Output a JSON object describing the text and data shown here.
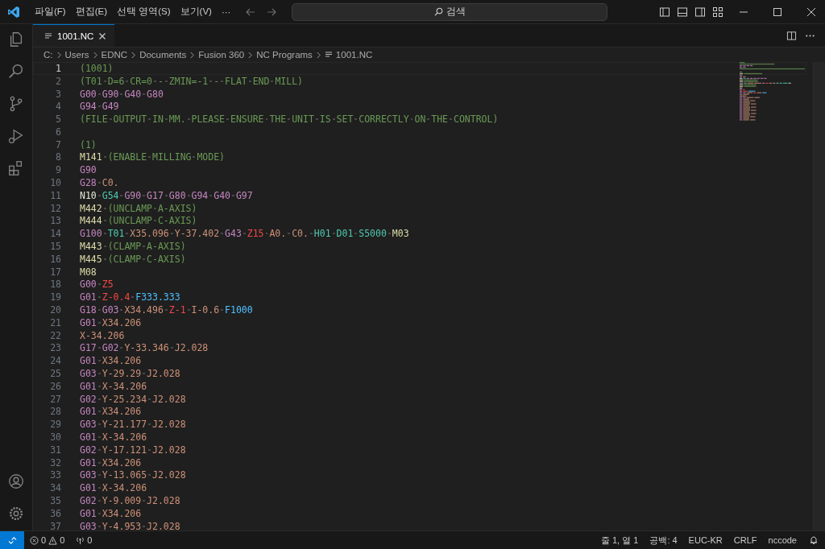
{
  "title_bar": {
    "menus": [
      "파일(F)",
      "편집(E)",
      "선택 영역(S)",
      "보기(V)",
      "···"
    ],
    "search": {
      "placeholder": "검색"
    }
  },
  "tabs": [
    {
      "label": "1001.NC",
      "selected": true
    }
  ],
  "breadcrumbs": [
    "C:",
    "Users",
    "EDNC",
    "Documents",
    "Fusion 360",
    "NC Programs",
    "1001.NC"
  ],
  "editor": {
    "lines": [
      {
        "number": "1",
        "current": true,
        "tokens": [
          {
            "kind": "comment",
            "text": "(1001)"
          }
        ]
      },
      {
        "number": "2",
        "current": false,
        "tokens": [
          {
            "kind": "comment",
            "text": "(T01 D=6 CR=0 - ZMIN=-1 - FLAT END MILL)"
          }
        ]
      },
      {
        "number": "3",
        "current": false,
        "tokens": [
          {
            "kind": "g",
            "text": "G00"
          },
          {
            "kind": "g",
            "text": "G90"
          },
          {
            "kind": "g",
            "text": "G40"
          },
          {
            "kind": "g",
            "text": "G80"
          }
        ]
      },
      {
        "number": "4",
        "current": false,
        "tokens": [
          {
            "kind": "g",
            "text": "G94"
          },
          {
            "kind": "g",
            "text": "G49"
          }
        ]
      },
      {
        "number": "5",
        "current": false,
        "tokens": [
          {
            "kind": "comment",
            "text": "(FILE OUTPUT IN MM. PLEASE ENSURE THE UNIT IS SET CORRECTLY ON THE CONTROL)"
          }
        ]
      },
      {
        "number": "6",
        "current": false
      },
      {
        "number": "7",
        "current": false,
        "tokens": [
          {
            "kind": "comment",
            "text": "(1)"
          }
        ]
      },
      {
        "number": "8",
        "current": false,
        "tokens": [
          {
            "kind": "m",
            "text": "M141"
          },
          {
            "kind": "comment",
            "text": "(ENABLE MILLING MODE)"
          }
        ]
      },
      {
        "number": "9",
        "current": false,
        "tokens": [
          {
            "kind": "g",
            "text": "G90"
          }
        ]
      },
      {
        "number": "10",
        "current": false,
        "tokens": [
          {
            "kind": "g",
            "text": "G28"
          },
          {
            "kind": "coord",
            "text": "C0."
          }
        ]
      },
      {
        "number": "11",
        "current": false,
        "tokens": [
          {
            "kind": "n",
            "text": "N10"
          },
          {
            "kind": "t",
            "text": "G54"
          },
          {
            "kind": "g",
            "text": "G90"
          },
          {
            "kind": "g",
            "text": "G17"
          },
          {
            "kind": "g",
            "text": "G80"
          },
          {
            "kind": "g",
            "text": "G94"
          },
          {
            "kind": "g",
            "text": "G40"
          },
          {
            "kind": "g",
            "text": "G97"
          }
        ]
      },
      {
        "number": "12",
        "current": false,
        "tokens": [
          {
            "kind": "m",
            "text": "M442"
          },
          {
            "kind": "comment",
            "text": "(UNCLAMP A-AXIS)"
          }
        ]
      },
      {
        "number": "13",
        "current": false,
        "tokens": [
          {
            "kind": "m",
            "text": "M444"
          },
          {
            "kind": "comment",
            "text": "(UNCLAMP C-AXIS)"
          }
        ]
      },
      {
        "number": "14",
        "current": false,
        "tokens": [
          {
            "kind": "g",
            "text": "G100"
          },
          {
            "kind": "t",
            "text": "T01"
          },
          {
            "kind": "coord",
            "text": "X35.096"
          },
          {
            "kind": "coord",
            "text": "Y-37.402"
          },
          {
            "kind": "g",
            "text": "G43"
          },
          {
            "kind": "z",
            "text": "Z15"
          },
          {
            "kind": "coord",
            "text": "A0."
          },
          {
            "kind": "coord",
            "text": "C0."
          },
          {
            "kind": "t",
            "text": "H01"
          },
          {
            "kind": "t",
            "text": "D01"
          },
          {
            "kind": "t",
            "text": "S5000"
          },
          {
            "kind": "m",
            "text": "M03"
          }
        ]
      },
      {
        "number": "15",
        "current": false,
        "tokens": [
          {
            "kind": "m",
            "text": "M443"
          },
          {
            "kind": "comment",
            "text": "(CLAMP A-AXIS)"
          }
        ]
      },
      {
        "number": "16",
        "current": false,
        "tokens": [
          {
            "kind": "m",
            "text": "M445"
          },
          {
            "kind": "comment",
            "text": "(CLAMP C-AXIS)"
          }
        ]
      },
      {
        "number": "17",
        "current": false,
        "tokens": [
          {
            "kind": "m",
            "text": "M08"
          }
        ]
      },
      {
        "number": "18",
        "current": false,
        "tokens": [
          {
            "kind": "g",
            "text": "G00"
          },
          {
            "kind": "z",
            "text": "Z5"
          }
        ]
      },
      {
        "number": "19",
        "current": false,
        "tokens": [
          {
            "kind": "g",
            "text": "G01"
          },
          {
            "kind": "z",
            "text": "Z-0.4"
          },
          {
            "kind": "f",
            "text": "F333.333"
          }
        ]
      },
      {
        "number": "20",
        "current": false,
        "tokens": [
          {
            "kind": "g",
            "text": "G18"
          },
          {
            "kind": "g",
            "text": "G03"
          },
          {
            "kind": "coord",
            "text": "X34.496"
          },
          {
            "kind": "z",
            "text": "Z-1"
          },
          {
            "kind": "coord",
            "text": "I-0.6"
          },
          {
            "kind": "f",
            "text": "F1000"
          }
        ]
      },
      {
        "number": "21",
        "current": false,
        "tokens": [
          {
            "kind": "g",
            "text": "G01"
          },
          {
            "kind": "coord",
            "text": "X34.206"
          }
        ]
      },
      {
        "number": "22",
        "current": false,
        "tokens": [
          {
            "kind": "coord",
            "text": "X-34.206"
          }
        ]
      },
      {
        "number": "23",
        "current": false,
        "tokens": [
          {
            "kind": "g",
            "text": "G17"
          },
          {
            "kind": "g",
            "text": "G02"
          },
          {
            "kind": "coord",
            "text": "Y-33.346"
          },
          {
            "kind": "coord",
            "text": "J2.028"
          }
        ]
      },
      {
        "number": "24",
        "current": false,
        "tokens": [
          {
            "kind": "g",
            "text": "G01"
          },
          {
            "kind": "coord",
            "text": "X34.206"
          }
        ]
      },
      {
        "number": "25",
        "current": false,
        "tokens": [
          {
            "kind": "g",
            "text": "G03"
          },
          {
            "kind": "coord",
            "text": "Y-29.29"
          },
          {
            "kind": "coord",
            "text": "J2.028"
          }
        ]
      },
      {
        "number": "26",
        "current": false,
        "tokens": [
          {
            "kind": "g",
            "text": "G01"
          },
          {
            "kind": "coord",
            "text": "X-34.206"
          }
        ]
      },
      {
        "number": "27",
        "current": false,
        "tokens": [
          {
            "kind": "g",
            "text": "G02"
          },
          {
            "kind": "coord",
            "text": "Y-25.234"
          },
          {
            "kind": "coord",
            "text": "J2.028"
          }
        ]
      },
      {
        "number": "28",
        "current": false,
        "tokens": [
          {
            "kind": "g",
            "text": "G01"
          },
          {
            "kind": "coord",
            "text": "X34.206"
          }
        ]
      },
      {
        "number": "29",
        "current": false,
        "tokens": [
          {
            "kind": "g",
            "text": "G03"
          },
          {
            "kind": "coord",
            "text": "Y-21.177"
          },
          {
            "kind": "coord",
            "text": "J2.028"
          }
        ]
      },
      {
        "number": "30",
        "current": false,
        "tokens": [
          {
            "kind": "g",
            "text": "G01"
          },
          {
            "kind": "coord",
            "text": "X-34.206"
          }
        ]
      },
      {
        "number": "31",
        "current": false,
        "tokens": [
          {
            "kind": "g",
            "text": "G02"
          },
          {
            "kind": "coord",
            "text": "Y-17.121"
          },
          {
            "kind": "coord",
            "text": "J2.028"
          }
        ]
      },
      {
        "number": "32",
        "current": false,
        "tokens": [
          {
            "kind": "g",
            "text": "G01"
          },
          {
            "kind": "coord",
            "text": "X34.206"
          }
        ]
      },
      {
        "number": "33",
        "current": false,
        "tokens": [
          {
            "kind": "g",
            "text": "G03"
          },
          {
            "kind": "coord",
            "text": "Y-13.065"
          },
          {
            "kind": "coord",
            "text": "J2.028"
          }
        ]
      },
      {
        "number": "34",
        "current": false,
        "tokens": [
          {
            "kind": "g",
            "text": "G01"
          },
          {
            "kind": "coord",
            "text": "X-34.206"
          }
        ]
      },
      {
        "number": "35",
        "current": false,
        "tokens": [
          {
            "kind": "g",
            "text": "G02"
          },
          {
            "kind": "coord",
            "text": "Y-9.009"
          },
          {
            "kind": "coord",
            "text": "J2.028"
          }
        ]
      },
      {
        "number": "36",
        "current": false,
        "tokens": [
          {
            "kind": "g",
            "text": "G01"
          },
          {
            "kind": "coord",
            "text": "X34.206"
          }
        ]
      },
      {
        "number": "37",
        "current": false,
        "tokens": [
          {
            "kind": "g",
            "text": "G03"
          },
          {
            "kind": "coord",
            "text": "Y-4.953"
          },
          {
            "kind": "coord",
            "text": "J2.028"
          }
        ]
      }
    ]
  },
  "status_bar": {
    "errors": "0",
    "warnings": "0",
    "ports": "0",
    "position": "줄 1, 열 1",
    "indent": "공백: 4",
    "encoding": "EUC-KR",
    "line_ending": "CRLF",
    "language": "nccode"
  }
}
